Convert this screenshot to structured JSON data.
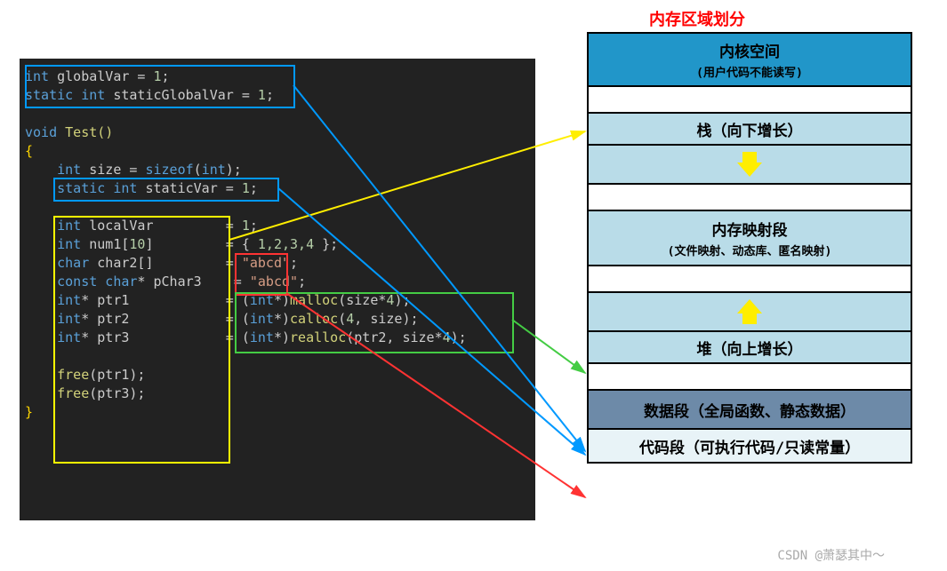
{
  "title": "内存区域划分",
  "code": {
    "l1a": "int",
    "l1b": " globalVar = ",
    "l1c": "1",
    "l1d": ";",
    "l2a": "static int",
    "l2b": " staticGlobalVar = ",
    "l2c": "1",
    "l2d": ";",
    "l4a": "void",
    "l4b": " Test()",
    "l5": "{",
    "l6a": "    int",
    "l6b": " size = ",
    "l6c": "sizeof",
    "l6d": "(",
    "l6e": "int",
    "l6f": ");",
    "l7a": "    static int",
    "l7b": " staticVar = ",
    "l7c": "1",
    "l7d": ";",
    "l9a": "    int",
    "l9b": " localVar         = ",
    "l9c": "1",
    "l9d": ";",
    "l10a": "    int",
    "l10b": " num1[",
    "l10c": "10",
    "l10d": "]         = { ",
    "l10e": "1,2,3,4",
    "l10f": " };",
    "l11a": "    char",
    "l11b": " char2[]         = ",
    "l11c": "\"abcd\"",
    "l11d": ";",
    "l12a": "    const char",
    "l12b": "* pChar3    = ",
    "l12c": "\"abcd\"",
    "l12d": ";",
    "l13a": "    int",
    "l13b": "* ptr1            = (",
    "l13c": "int",
    "l13d": "*)",
    "l13e": "malloc",
    "l13f": "(size*",
    "l13g": "4",
    "l13h": ");",
    "l14a": "    int",
    "l14b": "* ptr2            = (",
    "l14c": "int",
    "l14d": "*)",
    "l14e": "calloc",
    "l14f": "(",
    "l14g": "4",
    "l14h": ", size);",
    "l15a": "    int",
    "l15b": "* ptr3            = (",
    "l15c": "int",
    "l15d": "*)",
    "l15e": "realloc",
    "l15f": "(ptr2, size*",
    "l15g": "4",
    "l15h": ");",
    "l17a": "    free",
    "l17b": "(ptr1);",
    "l18a": "    free",
    "l18b": "(ptr3);",
    "l19": "}"
  },
  "memory": {
    "kernel_main": "内核空间",
    "kernel_sub": "(用户代码不能读写)",
    "stack": "栈（向下增长）",
    "mmap_main": "内存映射段",
    "mmap_sub": "(文件映射、动态库、匿名映射)",
    "heap": "堆（向上增长）",
    "dataseg": "数据段（全局函数、静态数据）",
    "codeseg": "代码段（可执行代码/只读常量）"
  },
  "watermark": "CSDN @萧瑟其中～"
}
